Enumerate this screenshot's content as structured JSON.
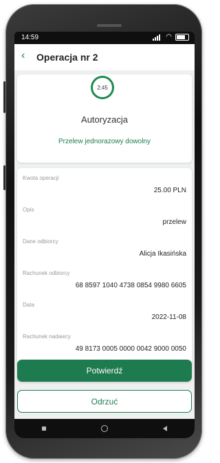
{
  "status_bar": {
    "time": "14:59",
    "icons": [
      "signal-icon",
      "wifi-icon",
      "battery-icon"
    ]
  },
  "header": {
    "back_icon": "chevron-left-icon",
    "title": "Operacja nr 2"
  },
  "authorization": {
    "timer": "2:45",
    "title": "Autoryzacja",
    "subtitle": "Przelew jednorazowy dowolny"
  },
  "details": [
    {
      "label": "Kwota operacji",
      "value": "25.00 PLN"
    },
    {
      "label": "Opis",
      "value": "przelew"
    },
    {
      "label": "Dane odbiorcy",
      "value": "Alicja Ikasińska"
    },
    {
      "label": "Rachunek odbiorcy",
      "value": "68 8597 1040 4738 0854 9980 6605"
    },
    {
      "label": "Data",
      "value": "2022-11-08"
    },
    {
      "label": "Rachunek nadawcy",
      "value": "49 8173 0005 0000 0042 9000 0050"
    }
  ],
  "buttons": {
    "confirm": "Potwierdź",
    "reject": "Odrzuć"
  },
  "colors": {
    "accent": "#1e7a4f",
    "background": "#eef1f0"
  }
}
